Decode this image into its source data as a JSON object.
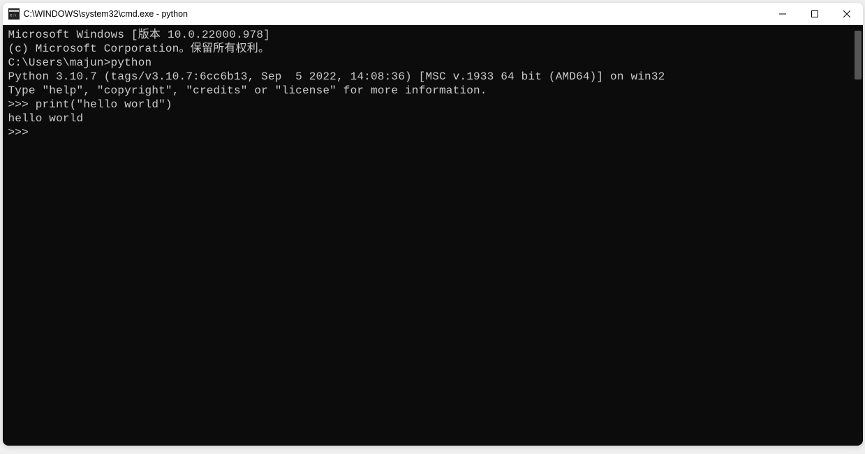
{
  "window": {
    "title": "C:\\WINDOWS\\system32\\cmd.exe - python"
  },
  "terminal": {
    "lines": [
      "Microsoft Windows [版本 10.0.22000.978]",
      "(c) Microsoft Corporation。保留所有权利。",
      "",
      "C:\\Users\\majun>python",
      "Python 3.10.7 (tags/v3.10.7:6cc6b13, Sep  5 2022, 14:08:36) [MSC v.1933 64 bit (AMD64)] on win32",
      "Type \"help\", \"copyright\", \"credits\" or \"license\" for more information.",
      ">>> print(\"hello world\")",
      "hello world",
      ">>>"
    ]
  }
}
